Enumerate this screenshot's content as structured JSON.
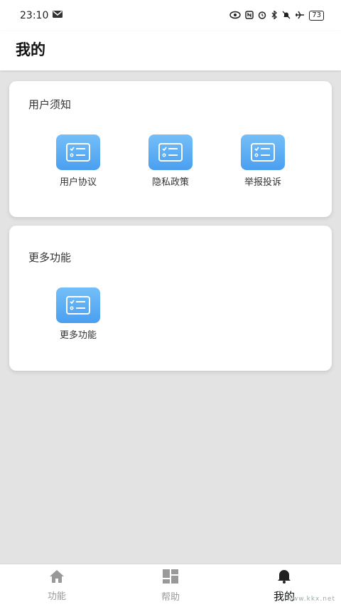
{
  "status_bar": {
    "time": "23:10",
    "battery": "73"
  },
  "header": {
    "title": "我的"
  },
  "sections": [
    {
      "title": "用户须知",
      "items": [
        {
          "label": "用户协议"
        },
        {
          "label": "隐私政策"
        },
        {
          "label": "举报投诉"
        }
      ]
    },
    {
      "title": "更多功能",
      "items": [
        {
          "label": "更多功能"
        }
      ]
    }
  ],
  "bottom_nav": {
    "items": [
      {
        "label": "功能"
      },
      {
        "label": "帮助"
      },
      {
        "label": "我的"
      }
    ],
    "active": "我的"
  },
  "watermark": {
    "text": "www.kkx.net"
  },
  "colors": {
    "tile_accent": "#4a9ff0",
    "active_nav": "#111111"
  }
}
